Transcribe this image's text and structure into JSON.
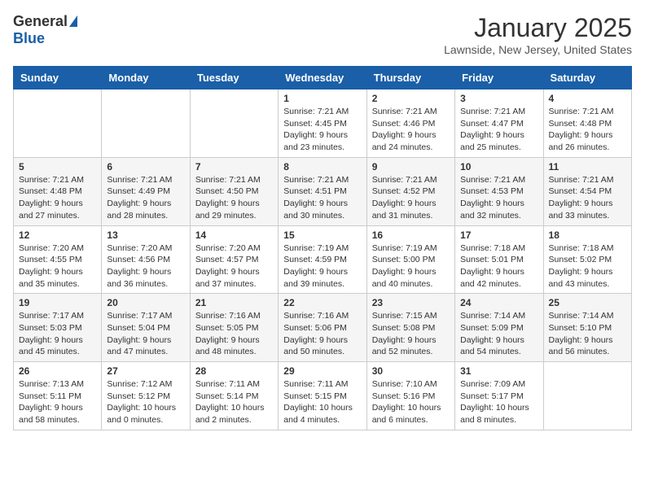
{
  "header": {
    "logo_general": "General",
    "logo_blue": "Blue",
    "month_title": "January 2025",
    "subtitle": "Lawnside, New Jersey, United States"
  },
  "weekdays": [
    "Sunday",
    "Monday",
    "Tuesday",
    "Wednesday",
    "Thursday",
    "Friday",
    "Saturday"
  ],
  "weeks": [
    [
      {
        "day": "",
        "info": ""
      },
      {
        "day": "",
        "info": ""
      },
      {
        "day": "",
        "info": ""
      },
      {
        "day": "1",
        "info": "Sunrise: 7:21 AM\nSunset: 4:45 PM\nDaylight: 9 hours and 23 minutes."
      },
      {
        "day": "2",
        "info": "Sunrise: 7:21 AM\nSunset: 4:46 PM\nDaylight: 9 hours and 24 minutes."
      },
      {
        "day": "3",
        "info": "Sunrise: 7:21 AM\nSunset: 4:47 PM\nDaylight: 9 hours and 25 minutes."
      },
      {
        "day": "4",
        "info": "Sunrise: 7:21 AM\nSunset: 4:48 PM\nDaylight: 9 hours and 26 minutes."
      }
    ],
    [
      {
        "day": "5",
        "info": "Sunrise: 7:21 AM\nSunset: 4:48 PM\nDaylight: 9 hours and 27 minutes."
      },
      {
        "day": "6",
        "info": "Sunrise: 7:21 AM\nSunset: 4:49 PM\nDaylight: 9 hours and 28 minutes."
      },
      {
        "day": "7",
        "info": "Sunrise: 7:21 AM\nSunset: 4:50 PM\nDaylight: 9 hours and 29 minutes."
      },
      {
        "day": "8",
        "info": "Sunrise: 7:21 AM\nSunset: 4:51 PM\nDaylight: 9 hours and 30 minutes."
      },
      {
        "day": "9",
        "info": "Sunrise: 7:21 AM\nSunset: 4:52 PM\nDaylight: 9 hours and 31 minutes."
      },
      {
        "day": "10",
        "info": "Sunrise: 7:21 AM\nSunset: 4:53 PM\nDaylight: 9 hours and 32 minutes."
      },
      {
        "day": "11",
        "info": "Sunrise: 7:21 AM\nSunset: 4:54 PM\nDaylight: 9 hours and 33 minutes."
      }
    ],
    [
      {
        "day": "12",
        "info": "Sunrise: 7:20 AM\nSunset: 4:55 PM\nDaylight: 9 hours and 35 minutes."
      },
      {
        "day": "13",
        "info": "Sunrise: 7:20 AM\nSunset: 4:56 PM\nDaylight: 9 hours and 36 minutes."
      },
      {
        "day": "14",
        "info": "Sunrise: 7:20 AM\nSunset: 4:57 PM\nDaylight: 9 hours and 37 minutes."
      },
      {
        "day": "15",
        "info": "Sunrise: 7:19 AM\nSunset: 4:59 PM\nDaylight: 9 hours and 39 minutes."
      },
      {
        "day": "16",
        "info": "Sunrise: 7:19 AM\nSunset: 5:00 PM\nDaylight: 9 hours and 40 minutes."
      },
      {
        "day": "17",
        "info": "Sunrise: 7:18 AM\nSunset: 5:01 PM\nDaylight: 9 hours and 42 minutes."
      },
      {
        "day": "18",
        "info": "Sunrise: 7:18 AM\nSunset: 5:02 PM\nDaylight: 9 hours and 43 minutes."
      }
    ],
    [
      {
        "day": "19",
        "info": "Sunrise: 7:17 AM\nSunset: 5:03 PM\nDaylight: 9 hours and 45 minutes."
      },
      {
        "day": "20",
        "info": "Sunrise: 7:17 AM\nSunset: 5:04 PM\nDaylight: 9 hours and 47 minutes."
      },
      {
        "day": "21",
        "info": "Sunrise: 7:16 AM\nSunset: 5:05 PM\nDaylight: 9 hours and 48 minutes."
      },
      {
        "day": "22",
        "info": "Sunrise: 7:16 AM\nSunset: 5:06 PM\nDaylight: 9 hours and 50 minutes."
      },
      {
        "day": "23",
        "info": "Sunrise: 7:15 AM\nSunset: 5:08 PM\nDaylight: 9 hours and 52 minutes."
      },
      {
        "day": "24",
        "info": "Sunrise: 7:14 AM\nSunset: 5:09 PM\nDaylight: 9 hours and 54 minutes."
      },
      {
        "day": "25",
        "info": "Sunrise: 7:14 AM\nSunset: 5:10 PM\nDaylight: 9 hours and 56 minutes."
      }
    ],
    [
      {
        "day": "26",
        "info": "Sunrise: 7:13 AM\nSunset: 5:11 PM\nDaylight: 9 hours and 58 minutes."
      },
      {
        "day": "27",
        "info": "Sunrise: 7:12 AM\nSunset: 5:12 PM\nDaylight: 10 hours and 0 minutes."
      },
      {
        "day": "28",
        "info": "Sunrise: 7:11 AM\nSunset: 5:14 PM\nDaylight: 10 hours and 2 minutes."
      },
      {
        "day": "29",
        "info": "Sunrise: 7:11 AM\nSunset: 5:15 PM\nDaylight: 10 hours and 4 minutes."
      },
      {
        "day": "30",
        "info": "Sunrise: 7:10 AM\nSunset: 5:16 PM\nDaylight: 10 hours and 6 minutes."
      },
      {
        "day": "31",
        "info": "Sunrise: 7:09 AM\nSunset: 5:17 PM\nDaylight: 10 hours and 8 minutes."
      },
      {
        "day": "",
        "info": ""
      }
    ]
  ]
}
